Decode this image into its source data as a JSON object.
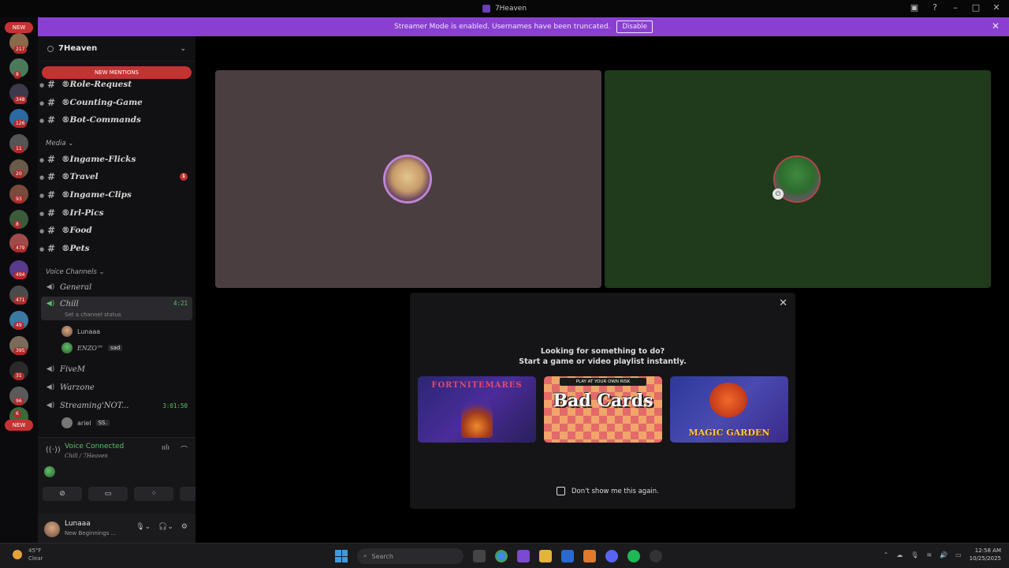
{
  "window": {
    "title": "7Heaven",
    "controls": [
      "inbox-icon",
      "help-icon",
      "minimize-icon",
      "maximize-icon",
      "close-icon"
    ]
  },
  "banner": {
    "text": "Streamer Mode is enabled. Usernames have been truncated.",
    "button": "Disable"
  },
  "servers": {
    "new_top": "NEW",
    "new_bottom": "NEW",
    "badges": [
      "217",
      "8",
      "348",
      "126",
      "11",
      "20",
      "93",
      "8",
      "479",
      "494",
      "471",
      "49",
      "395",
      "31",
      "96",
      "6"
    ]
  },
  "guild": {
    "name": "7Heaven",
    "new_mentions": "NEW MENTIONS",
    "text_channels": [
      "®Role-Request",
      "®Counting-Game",
      "®Bot-Commands"
    ],
    "media_category": "Media",
    "media_channels": [
      {
        "name": "®Ingame-Flicks",
        "unread": ""
      },
      {
        "name": "®Travel",
        "unread": "1"
      },
      {
        "name": "®Ingame-Clips",
        "unread": ""
      },
      {
        "name": "®Irl-Pics",
        "unread": ""
      },
      {
        "name": "®Food",
        "unread": ""
      },
      {
        "name": "®Pets",
        "unread": ""
      }
    ],
    "voice_category": "Voice Channels",
    "voice_channels": {
      "general": "General",
      "chill": "Chill",
      "chill_time": "4:21",
      "chill_status": "Set a channel status",
      "chill_users": [
        {
          "name": "Lunaaa",
          "tag": ""
        },
        {
          "name": "ENZO™",
          "tag": "sad"
        }
      ],
      "fivem": "FiveM",
      "warzone": "Warzone",
      "streaming": "Streaming'NOT...",
      "streaming_time": "3:01:50",
      "streaming_users": [
        {
          "name": "ariel",
          "tag": "SS."
        }
      ]
    }
  },
  "voice_panel": {
    "status": "Voice Connected",
    "location": "Chill / 7Heaven",
    "buttons": [
      "camera-off-icon",
      "screen-share-icon",
      "activities-icon",
      "soundboard-icon"
    ]
  },
  "me": {
    "name": "Lunaaa",
    "status": "New Beginnings ..."
  },
  "modal": {
    "line1": "Looking for something to do?",
    "line2": "Start a game or video playlist instantly.",
    "cards": [
      {
        "name": "FORTNITEMARES"
      },
      {
        "name": "Bad Cards",
        "tag": "PLAY AT YOUR OWN RISK"
      },
      {
        "name": "MAGIC GARDEN"
      }
    ],
    "checkbox_label": "Don't show me this again."
  },
  "taskbar": {
    "weather_temp": "45°F",
    "weather_desc": "Clear",
    "search_placeholder": "Search",
    "time": "12:58 AM",
    "date": "10/25/2025"
  }
}
